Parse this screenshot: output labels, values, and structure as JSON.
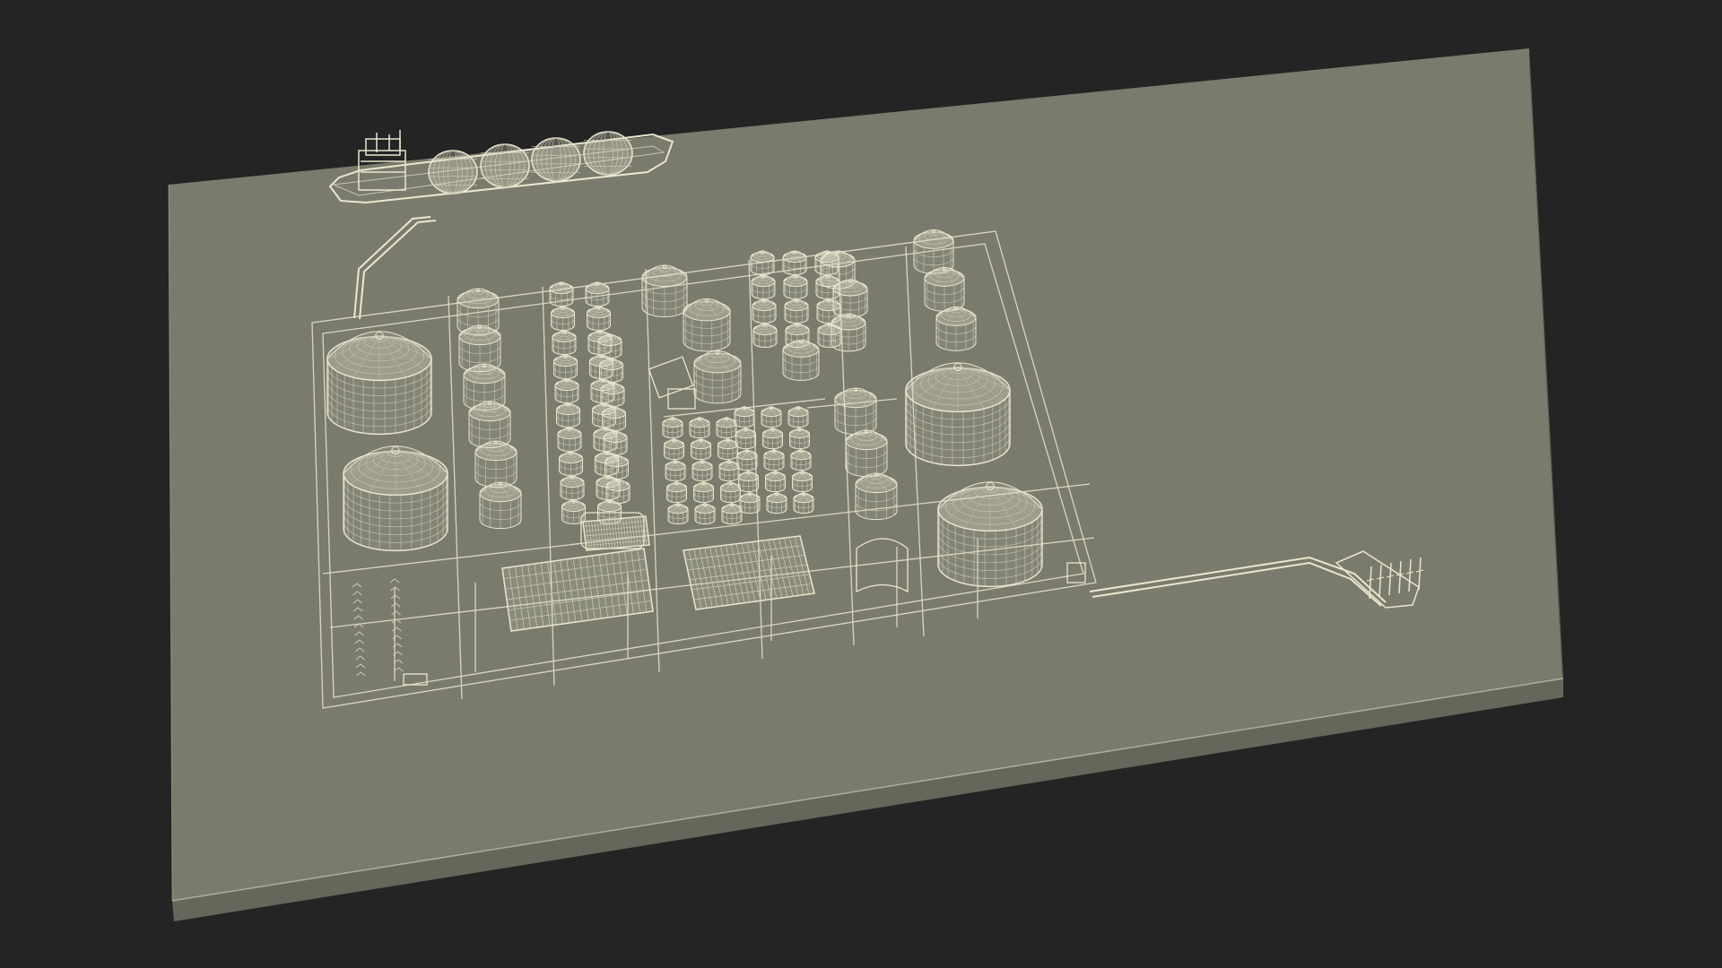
{
  "scene": {
    "subject": "",
    "background_color": "#242424",
    "platform_top_color": "#7a7b6c",
    "platform_side_color": "#6c6d5f",
    "platform_front_color": "#626356",
    "wireframe_color": "#e9e7cf",
    "wireframe_dim_color": "#cfcdb5"
  },
  "elements": {
    "ship": {
      "cargo_domes": 4
    },
    "large_tanks": 4,
    "medium_tank_rows": 12,
    "small_tank_clusters": 4,
    "warehouses": 3,
    "loading_arm_spikes": 6
  }
}
